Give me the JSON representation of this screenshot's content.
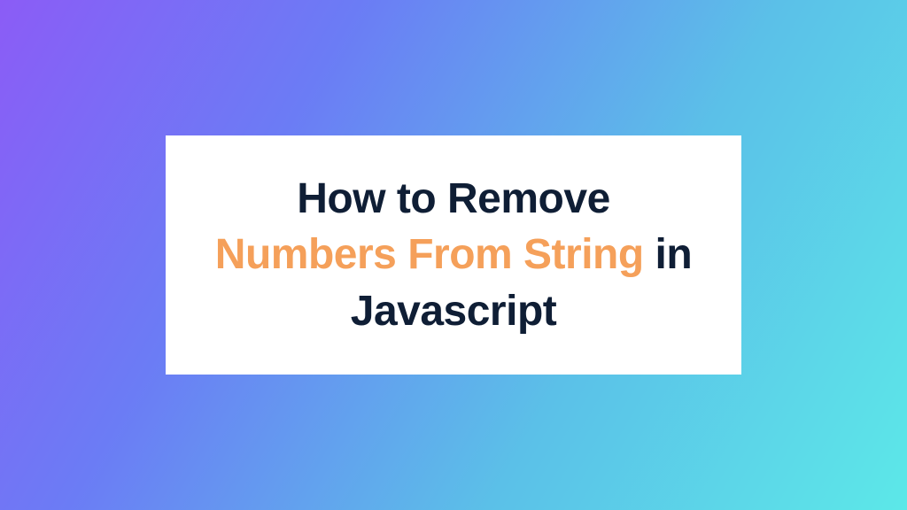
{
  "title": {
    "part1": "How to Remove",
    "part2": "Numbers From String",
    "part3": "in Javascript"
  },
  "colors": {
    "dark": "#0f1e35",
    "highlight": "#f5a05a",
    "gradient_start": "#8b5cf6",
    "gradient_end": "#5ce8e8"
  }
}
